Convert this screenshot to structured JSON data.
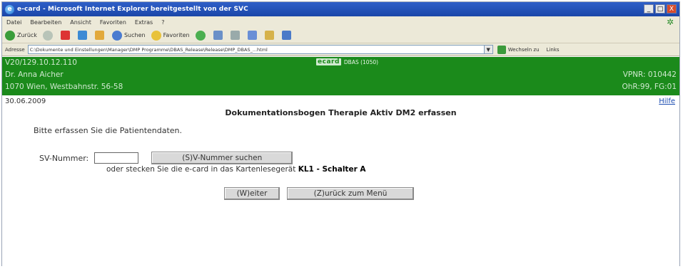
{
  "window": {
    "title": "e-card - Microsoft Internet Explorer bereitgestellt von der SVC",
    "buttons": {
      "min": "_",
      "max": "□",
      "close": "X"
    }
  },
  "menubar": {
    "items": [
      "Datei",
      "Bearbeiten",
      "Ansicht",
      "Favoriten",
      "Extras",
      "?"
    ]
  },
  "toolbar": {
    "back": "Zurück",
    "search": "Suchen",
    "favorites": "Favoriten"
  },
  "addressbar": {
    "label": "Adresse",
    "url": "C:\\Dokumente und Einstellungen\\Manager\\DMP Programme\\DBAS_Release\\Release\\DMP_DBAS_...html",
    "go": "Wechseln zu",
    "links": "Links"
  },
  "header": {
    "ip": "V20/129.10.12.110",
    "doctor": "Dr. Anna Aicher",
    "address": "1070 Wien, Westbahnstr. 56-58",
    "brand": "ecard",
    "system": "DBAS (1050)",
    "vpnr": "VPNR: 010442",
    "ohr": "OhR:99, FG:01"
  },
  "content": {
    "date": "30.06.2009",
    "help": "Hilfe",
    "heading": "Dokumentationsbogen Therapie Aktiv DM2 erfassen",
    "intro": "Bitte erfassen Sie die Patientendaten.",
    "sv_label": "SV-Nummer:",
    "sv_value": "",
    "search_button": "(S)V-Nummer suchen",
    "insert_text": "oder stecken Sie die e-card in das Kartenlesegerät",
    "card_reader": "KL1 - Schalter A",
    "next_button": "(W)eiter",
    "menu_button": "(Z)urück zum Menü"
  }
}
